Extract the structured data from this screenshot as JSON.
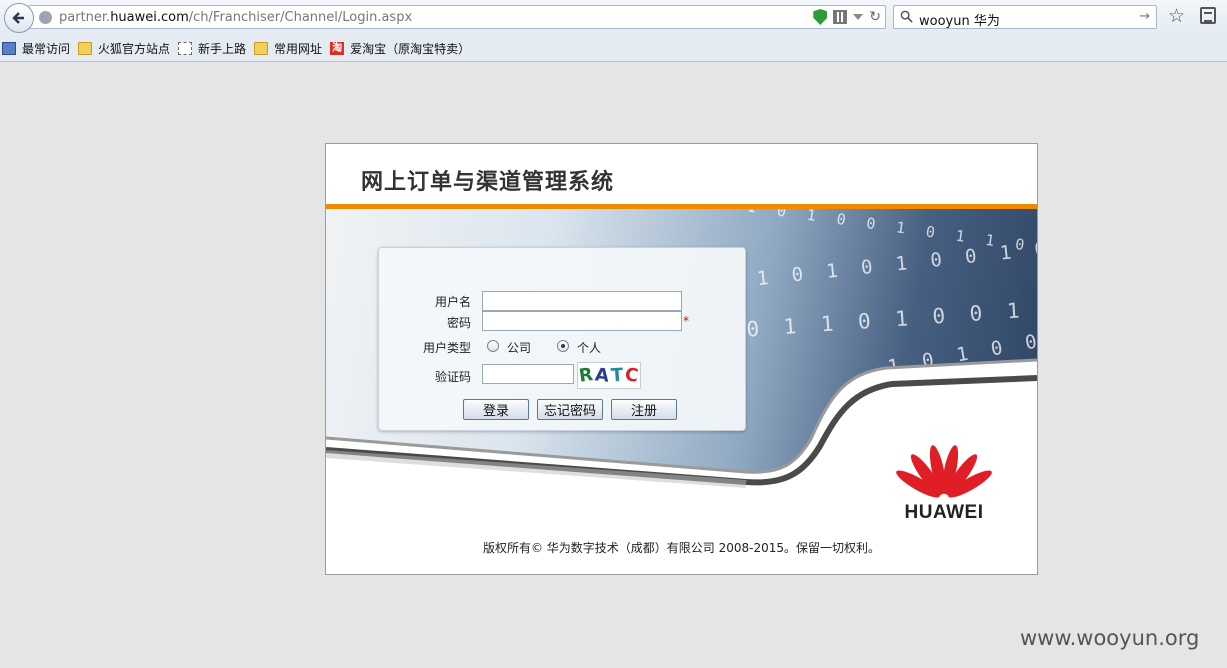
{
  "browser": {
    "url_prefix": "partner.",
    "url_domain": "huawei.com",
    "url_path": "/ch/Franchiser/Channel/Login.aspx",
    "search_value": "wooyun 华为",
    "bookmarks": [
      {
        "label": "最常访问",
        "icon": "recent-icon"
      },
      {
        "label": "火狐官方站点",
        "icon": "folder-icon"
      },
      {
        "label": "新手上路",
        "icon": "page-icon"
      },
      {
        "label": "常用网址",
        "icon": "folder-icon"
      },
      {
        "label": "爱淘宝（原淘宝特卖）",
        "icon": "taobao-icon",
        "icon_text": "淘"
      }
    ]
  },
  "page": {
    "title": "网上订单与渠道管理系统",
    "banner_binary": [
      "0 0 1 0 1 0 1 0 0 1 0 1 1 0 0 1",
      "1 0 1 0 1 0 0 1 0 1 0",
      "0 1 1 0 1 0 0 1 1 0 1",
      "1 0 1 0 0 1 0 1"
    ],
    "login": {
      "username_label": "用户名",
      "password_label": "密码",
      "required_mark": "*",
      "user_type_label": "用户类型",
      "user_type_options": [
        "公司",
        "个人"
      ],
      "user_type_selected": "个人",
      "captcha_label": "验证码",
      "captcha_chars": [
        "R",
        "A",
        "T",
        "C"
      ],
      "login_button": "登录",
      "forgot_button": "忘记密码",
      "register_button": "注册"
    },
    "brand": "HUAWEI",
    "copyright": "版权所有© 华为数字技术（成都）有限公司 2008-2015。保留一切权利。"
  },
  "watermark": "www.wooyun.org",
  "colors": {
    "accent_orange": "#f08a00",
    "huawei_red": "#e01e25",
    "page_bg": "#e5e5e5"
  }
}
